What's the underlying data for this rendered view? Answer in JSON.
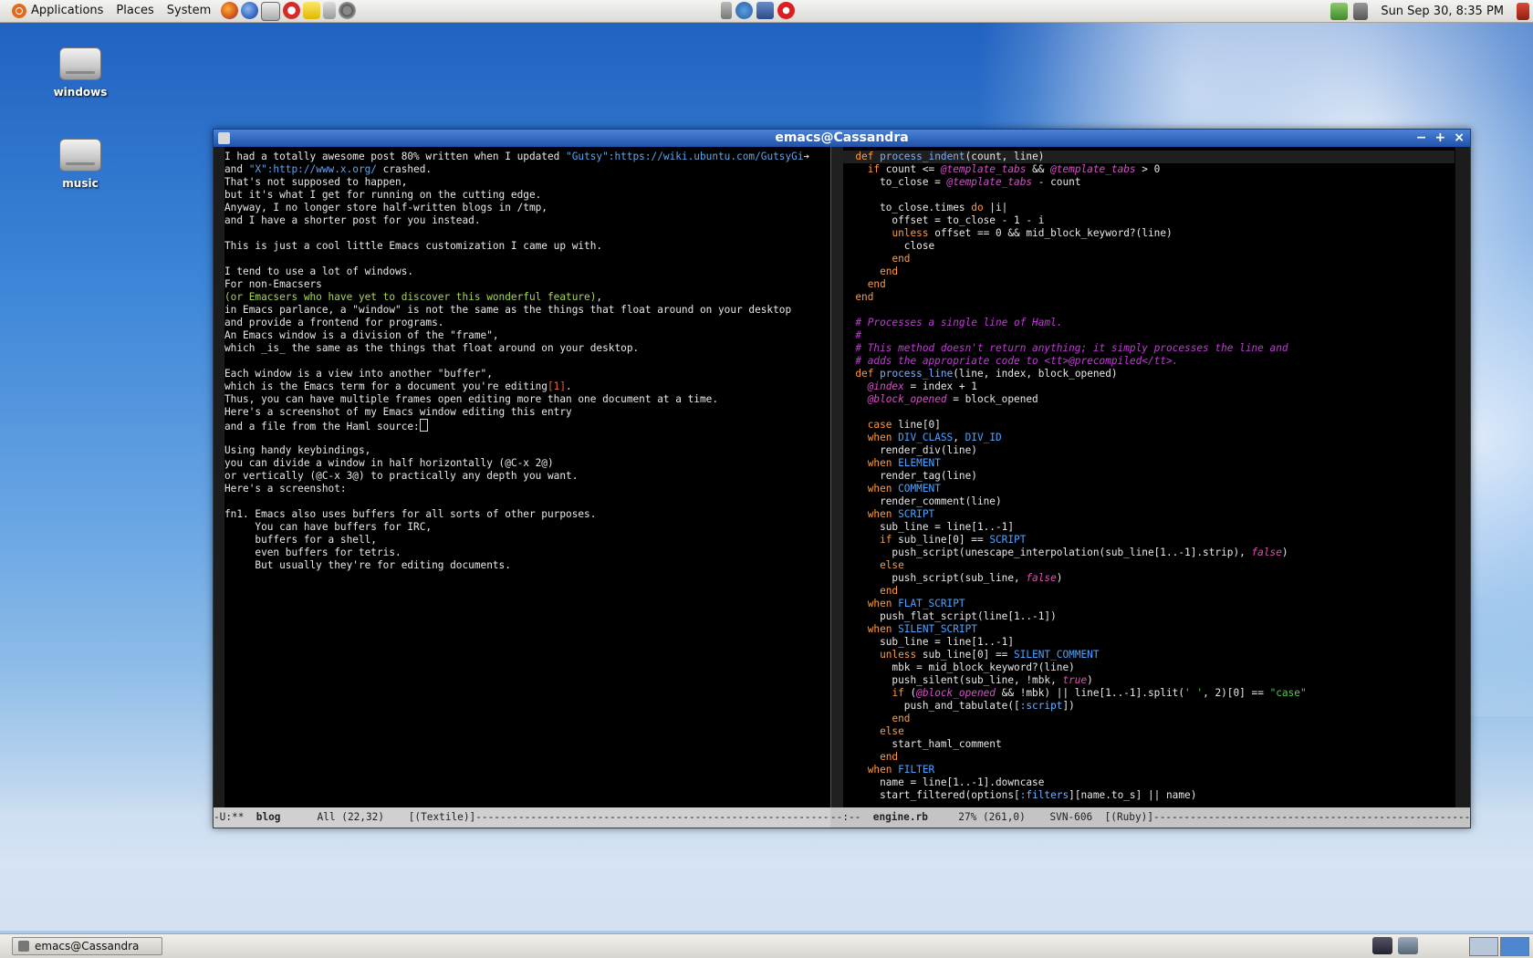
{
  "top_panel": {
    "menus": [
      "Applications",
      "Places",
      "System"
    ],
    "launchers": [
      "firefox-icon",
      "thunderbird-icon",
      "calculator-icon",
      "opera-icon",
      "notes-icon",
      "pidgin-icon",
      "settings-icon"
    ],
    "clock": "Sun Sep 30,  8:35 PM"
  },
  "desktop": {
    "icons": [
      {
        "label": "windows"
      },
      {
        "label": "music"
      }
    ]
  },
  "window": {
    "title": "emacs@Cassandra",
    "controls": [
      "−",
      "+",
      "×"
    ]
  },
  "left_buffer": {
    "lines": [
      "I had a totally awesome post 80% written when I updated \"Gutsy\":https://wiki.ubuntu.com/GutsyGi",
      "and \"X\":http://www.x.org/ crashed.",
      "That's not supposed to happen,",
      "but it's what I get for running on the cutting edge.",
      "Anyway, I no longer store half-written blogs in /tmp,",
      "and I have a shorter post for you instead.",
      "",
      "This is just a cool little Emacs customization I came up with.",
      "",
      "I tend to use a lot of windows.",
      "For non-Emacsers",
      "(or Emacsers who have yet to discover this wonderful feature),",
      "in Emacs parlance, a \"window\" is not the same as the things that float around on your desktop",
      "and provide a frontend for programs.",
      "An Emacs window is a division of the \"frame\",",
      "which _is_ the same as the things that float around on your desktop.",
      "",
      "Each window is a view into another \"buffer\",",
      "which is the Emacs term for a document you're editing[1].",
      "Thus, you can have multiple frames open editing more than one document at a time.",
      "Here's a screenshot of my Emacs window editing this entry",
      "and a file from the Haml source:",
      "",
      "Using handy keybindings,",
      "you can divide a window in half horizontally (@C-x 2@)",
      "or vertically (@C-x 3@) to practically any depth you want.",
      "Here's a screenshot:",
      "",
      "fn1. Emacs also uses buffers for all sorts of other purposes.",
      "     You can have buffers for IRC,",
      "     buffers for a shell,",
      "     even buffers for tetris.",
      "     But usually they're for editing documents."
    ],
    "modeline": {
      "status": "-U:**  ",
      "buffer": "blog",
      "position": "      All (22,32)    [(Textile)]",
      "fill": "--------------------------------------------------------------------------------"
    }
  },
  "right_buffer": {
    "lines": [
      "  def process_indent(count, line)",
      "    if count <= @template_tabs && @template_tabs > 0",
      "      to_close = @template_tabs - count",
      "",
      "      to_close.times do |i|",
      "        offset = to_close - 1 - i",
      "        unless offset == 0 && mid_block_keyword?(line)",
      "          close",
      "        end",
      "      end",
      "    end",
      "  end",
      "",
      "  # Processes a single line of Haml.",
      "  #",
      "  # This method doesn't return anything; it simply processes the line and",
      "  # adds the appropriate code to <tt>@precompiled</tt>.",
      "  def process_line(line, index, block_opened)",
      "    @index = index + 1",
      "    @block_opened = block_opened",
      "",
      "    case line[0]",
      "    when DIV_CLASS, DIV_ID",
      "      render_div(line)",
      "    when ELEMENT",
      "      render_tag(line)",
      "    when COMMENT",
      "      render_comment(line)",
      "    when SCRIPT",
      "      sub_line = line[1..-1]",
      "      if sub_line[0] == SCRIPT",
      "        push_script(unescape_interpolation(sub_line[1..-1].strip), false)",
      "      else",
      "        push_script(sub_line, false)",
      "      end",
      "    when FLAT_SCRIPT",
      "      push_flat_script(line[1..-1])",
      "    when SILENT_SCRIPT",
      "      sub_line = line[1..-1]",
      "      unless sub_line[0] == SILENT_COMMENT",
      "        mbk = mid_block_keyword?(line)",
      "        push_silent(sub_line, !mbk, true)",
      "        if (@block_opened && !mbk) || line[1..-1].split(' ', 2)[0] == \"case\"",
      "          push_and_tabulate([:script])",
      "        end",
      "      else",
      "        start_haml_comment",
      "      end",
      "    when FILTER",
      "      name = line[1..-1].downcase",
      "      start_filtered(options[:filters][name.to_s] || name)"
    ],
    "modeline": {
      "status": "--:--  ",
      "buffer": "engine.rb",
      "position": "     27% (261,0)    SVN-606  [(Ruby)]",
      "fill": "------------------------------------------------------------------------------------"
    }
  },
  "bottom_panel": {
    "task": "emacs@Cassandra"
  },
  "colors": {
    "keyword": "#ff9a3c",
    "ivar": "#d650c8",
    "constant": "#4ea3ff",
    "comment": "#c23ad8",
    "string": "#4dd04d",
    "title_bar": "#2a5fb8"
  }
}
